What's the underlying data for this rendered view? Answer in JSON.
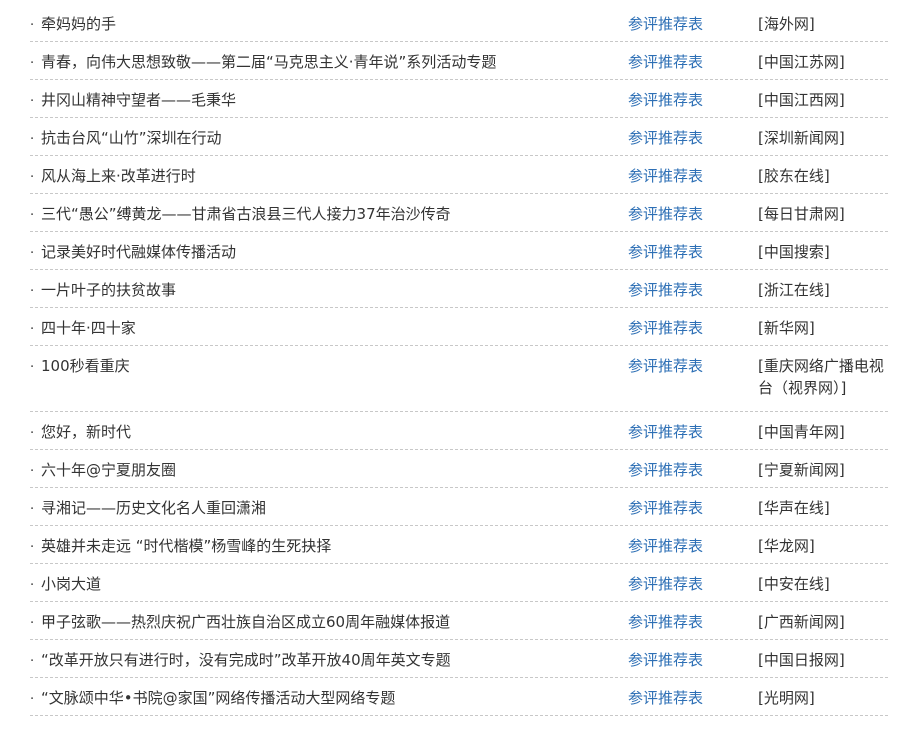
{
  "rows": [
    {
      "title": "牵妈妈的手",
      "link": "参评推荐表",
      "source": "[海外网]"
    },
    {
      "title": "青春，向伟大思想致敬——第二届“马克思主义·青年说”系列活动专题",
      "link": "参评推荐表",
      "source": "[中国江苏网]"
    },
    {
      "title": "井冈山精神守望者——毛秉华",
      "link": "参评推荐表",
      "source": "[中国江西网]"
    },
    {
      "title": "抗击台风“山竹”深圳在行动",
      "link": "参评推荐表",
      "source": "[深圳新闻网]"
    },
    {
      "title": "风从海上来·改革进行时",
      "link": "参评推荐表",
      "source": "[胶东在线]"
    },
    {
      "title": "三代“愚公”缚黄龙——甘肃省古浪县三代人接力37年治沙传奇",
      "link": "参评推荐表",
      "source": "[每日甘肃网]"
    },
    {
      "title": "记录美好时代融媒体传播活动",
      "link": "参评推荐表",
      "source": "[中国搜索]"
    },
    {
      "title": "一片叶子的扶贫故事",
      "link": "参评推荐表",
      "source": "[浙江在线]"
    },
    {
      "title": "四十年·四十家",
      "link": "参评推荐表",
      "source": "[新华网]"
    },
    {
      "title": "100秒看重庆",
      "link": "参评推荐表",
      "source": "[重庆网络广播电视台（视界网）]"
    },
    {
      "title": "您好，新时代",
      "link": "参评推荐表",
      "source": "[中国青年网]"
    },
    {
      "title": "六十年@宁夏朋友圈",
      "link": "参评推荐表",
      "source": "[宁夏新闻网]"
    },
    {
      "title": "寻湘记——历史文化名人重回潇湘",
      "link": "参评推荐表",
      "source": "[华声在线]"
    },
    {
      "title": "英雄并未走远 “时代楷模”杨雪峰的生死抉择",
      "link": "参评推荐表",
      "source": "[华龙网]"
    },
    {
      "title": "小岗大道",
      "link": "参评推荐表",
      "source": "[中安在线]"
    },
    {
      "title": "甲子弦歌——热烈庆祝广西壮族自治区成立60周年融媒体报道",
      "link": "参评推荐表",
      "source": "[广西新闻网]"
    },
    {
      "title": "“改革开放只有进行时，没有完成时”改革开放40周年英文专题",
      "link": "参评推荐表",
      "source": "[中国日报网]"
    },
    {
      "title": "“文脉颂中华•书院@家国”网络传播活动大型网络专题",
      "link": "参评推荐表",
      "source": "[光明网]"
    }
  ],
  "bullet": "·",
  "colors": {
    "link": "#2d6fb5",
    "text": "#333333",
    "divider": "#c8c8c8"
  }
}
